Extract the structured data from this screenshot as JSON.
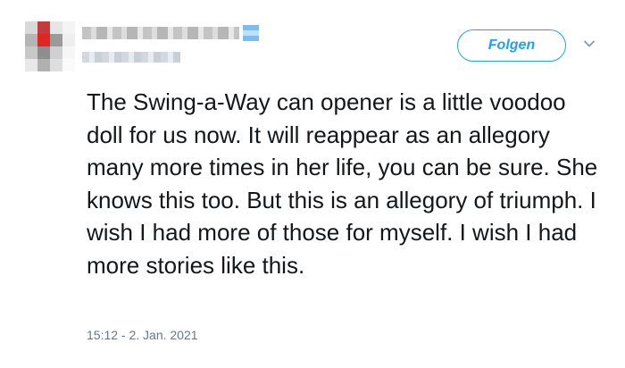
{
  "header": {
    "follow_label": "Folgen"
  },
  "tweet": {
    "text": "The Swing-a-Way can opener is a little voodoo doll for us now. It will reappear as an allegory many more times in her life, you can be sure. She knows this too. But this is an allegory of triumph. I wish I had more of those for myself. I wish I had more stories like this.",
    "timestamp": "15:12 - 2. Jan. 2021"
  },
  "colors": {
    "accent": "#1da1f2",
    "text": "#14171a",
    "muted": "#657786"
  }
}
